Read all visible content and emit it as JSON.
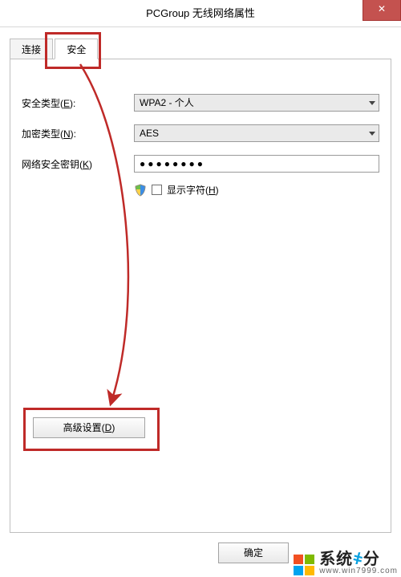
{
  "window": {
    "title": "PCGroup 无线网络属性",
    "close_glyph": "✕"
  },
  "tabs": {
    "connect": "连接",
    "security": "安全"
  },
  "form": {
    "security_type_label": "安全类型(E):",
    "security_type_value": "WPA2 - 个人",
    "encryption_type_label": "加密类型(N):",
    "encryption_type_value": "AES",
    "network_key_label": "网络安全密钥(K)",
    "network_key_value": "●●●●●●●●",
    "show_chars_label": "显示字符(H)"
  },
  "buttons": {
    "advanced": "高级设置(D)",
    "ok": "确定"
  },
  "watermark": {
    "main": "系统",
    "main_dot": "҂",
    "main_suffix": "分",
    "sub": "www.win7999.com"
  }
}
